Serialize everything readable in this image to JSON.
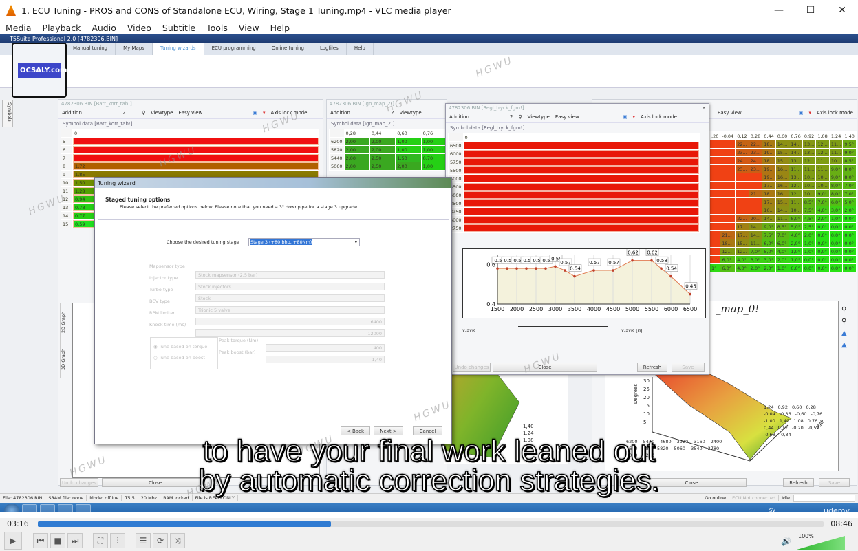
{
  "window": {
    "title": "1. ECU Tuning - PROS and CONS of Standalone ECU, Wiring, Stage 1 Tuning.mp4 - VLC media player",
    "minimize": "—",
    "maximize": "☐",
    "close": "✕"
  },
  "menu": [
    "Media",
    "Playback",
    "Audio",
    "Video",
    "Subtitle",
    "Tools",
    "View",
    "Help"
  ],
  "app": {
    "title": "T5Suite Professional 2.0 [4782306.BIN]",
    "tabs": [
      "Manual tuning",
      "My Maps",
      "Tuning wizards",
      "ECU programming",
      "Online tuning",
      "Logfiles",
      "Help"
    ],
    "active_tab": 2,
    "logo": "OCSALY.com",
    "symbols_tab": "Symbols"
  },
  "toolbar": {
    "mode": "Addition",
    "amount": "2",
    "viewtype_label": "Viewtype",
    "viewtype": "Easy view",
    "axis_lock": "Axis lock mode"
  },
  "batt": {
    "header": "4782306.BIN [Batt_korr_tab!]",
    "symlabel": "Symbol data [Batt_korr_tab!]",
    "col": "0",
    "rows": [
      {
        "r": "5",
        "v": "",
        "c": "#f01010"
      },
      {
        "r": "6",
        "v": "",
        "c": "#f01010"
      },
      {
        "r": "7",
        "v": "",
        "c": "#f01010"
      },
      {
        "r": "8",
        "v": "1,72",
        "c": "#b06000"
      },
      {
        "r": "9",
        "v": "1,85",
        "c": "#8a7a00"
      },
      {
        "r": "10",
        "v": "1,50",
        "c": "#6f9000"
      },
      {
        "r": "11",
        "v": "1,28",
        "c": "#50a000"
      },
      {
        "r": "12",
        "v": "0,94",
        "c": "#30c010"
      },
      {
        "r": "13",
        "v": "0,78",
        "c": "#25d015"
      },
      {
        "r": "14",
        "v": "0,77",
        "c": "#25d015"
      },
      {
        "r": "15",
        "v": "0,59",
        "c": "#20e020"
      }
    ]
  },
  "ign2": {
    "header": "4782306.BIN [Ign_map_2!]",
    "symlabel": "Symbol data [Ign_map_2!]",
    "cols": [
      "0,28",
      "0,44",
      "0,60",
      "0,76"
    ],
    "rows": [
      {
        "r": "6200",
        "v": [
          "2,00",
          "2,00",
          "1,00",
          "1,00"
        ]
      },
      {
        "r": "5820",
        "v": [
          "2,00",
          "2,00",
          "1,00",
          "1,00"
        ]
      },
      {
        "r": "5440",
        "v": [
          "2,00",
          "2,50",
          "1,50",
          "0,70"
        ]
      },
      {
        "r": "5060",
        "v": [
          "2,00",
          "2,50",
          "2,00",
          "1,00"
        ]
      }
    ]
  },
  "regl": {
    "header": "4782306.BIN [Regl_tryck_fgm!]",
    "symlabel": "Symbol data [Regl_tryck_fgm!]",
    "col": "0",
    "rows": [
      "6500",
      "6000",
      "5750",
      "5500",
      "5000",
      "4500",
      "4000",
      "3500",
      "3250",
      "3000",
      "2750"
    ],
    "xaxis_label": "x-axis",
    "xaxis_value": "x-axis [0]",
    "undo": "Undo changes",
    "close": "Close",
    "refresh": "Refresh",
    "save": "Save"
  },
  "chart_data": {
    "type": "line",
    "x": [
      1500,
      1750,
      2000,
      2250,
      2500,
      2750,
      3000,
      3250,
      3500,
      4000,
      4500,
      5000,
      5500,
      5750,
      6000,
      6500
    ],
    "values": [
      0.58,
      0.58,
      0.58,
      0.58,
      0.58,
      0.58,
      0.59,
      0.57,
      0.54,
      0.57,
      0.57,
      0.62,
      0.62,
      0.58,
      0.54,
      0.45
    ],
    "labels": [
      "0.5",
      "0.5",
      "0.5",
      "0.5",
      "0.5",
      "0.5",
      "0.5(",
      "0.57",
      "0.54",
      "0.57",
      "0.57",
      "0.62",
      "0.62",
      "0.58",
      "0.54",
      "0.45"
    ],
    "xticks": [
      "1500",
      "2000",
      "2500",
      "3000",
      "3500",
      "4000",
      "4500",
      "5000",
      "5500",
      "6000",
      "6500"
    ],
    "yticks": [
      "0.4",
      "0.6"
    ],
    "ylim": [
      0.4,
      0.65
    ],
    "xlim": [
      1500,
      6500
    ],
    "grid": true
  },
  "ign0": {
    "title": "_map_0!",
    "cols": [
      ",20",
      "-0,04",
      "0,12",
      "0,28",
      "0,44",
      "0,60",
      "0,76",
      "0,92",
      "1,08",
      "1,24",
      "1,40"
    ],
    "rows": [
      [
        "",
        "",
        "22...",
        "22...",
        "18...",
        "14...",
        "14...",
        "13...",
        "12...",
        "11...",
        "9,5°"
      ],
      [
        "",
        "",
        "23...",
        "23...",
        "19...",
        "15...",
        "14...",
        "13...",
        "12...",
        "11...",
        "9,0°"
      ],
      [
        "",
        "",
        "24...",
        "24...",
        "18...",
        "15...",
        "13...",
        "12...",
        "11...",
        "10...",
        "8,5°"
      ],
      [
        "",
        "",
        "23...",
        "23...",
        "19...",
        "16...",
        "11...",
        "11...",
        "11...",
        "9,0°",
        "8,0°"
      ],
      [
        "",
        "",
        "",
        "",
        "19...",
        "16...",
        "13...",
        "10...",
        "10...",
        "9,0°",
        "8,0°"
      ],
      [
        "",
        "",
        "",
        "",
        "17...",
        "16...",
        "12...",
        "10...",
        "10...",
        "8,0°",
        "7,0°"
      ],
      [
        "",
        "",
        "",
        "21...",
        "18...",
        "16...",
        "12...",
        "10...",
        "9,0°",
        "8,0°",
        "7,0°"
      ],
      [
        "",
        "",
        "",
        "",
        "17...",
        "15...",
        "11...",
        "8,5°",
        "7,0°",
        "6,0°",
        "5,0°"
      ],
      [
        "",
        "",
        "",
        "",
        "16...",
        "14...",
        "10...",
        "7,5°",
        "4,0°",
        "3,0°",
        "2,0°"
      ],
      [
        "",
        "",
        "22...",
        "20...",
        "14...",
        "11...",
        "8,0°",
        "4,5°",
        "2,0°",
        "1,0°",
        "0,0°"
      ],
      [
        "",
        "",
        "17...",
        "14...",
        "9,0°",
        "8,5°",
        "5,0°",
        "2,5°",
        "0,0°",
        "0,0°",
        "0,0°"
      ],
      [
        "",
        "21...",
        "17...",
        "14...",
        "7,5°",
        "7,0°",
        "4,0°",
        "2,0°",
        "0,0°",
        "0,0°",
        "0,0°"
      ],
      [
        "",
        "18...",
        "15...",
        "11...",
        "6,0°",
        "6,0°",
        "2,0°",
        "1,0°",
        "0,0°",
        "0,0°",
        "0,0°"
      ],
      [
        "",
        "12...",
        "12...",
        "7,0°",
        "5,0°",
        "4,0°",
        "1,0°",
        "1,0°",
        "0,0°",
        "0,0°",
        "0,0°"
      ],
      [
        "",
        "6,0°",
        "4,0°",
        "3,0°",
        "3,0°",
        "2,0°",
        "1,0°",
        "0,0°",
        "0,0°",
        "0,0°",
        "0,0°"
      ],
      [
        "1°",
        "6,0°",
        "4,0°",
        "2,0°",
        "2,0°",
        "1,0°",
        "0,0°",
        "0,0°",
        "0,0°",
        "0,0°",
        "0,0°"
      ]
    ],
    "zlabel": "Degrees",
    "ylabel": "MAP",
    "zticks": [
      "30",
      "25",
      "20",
      "15",
      "10",
      "5"
    ],
    "rpm_ticks": [
      "6200",
      "5440",
      "4680",
      "3920",
      "3160",
      "2400",
      "1640",
      "880",
      "5820",
      "5060",
      "3540",
      "2780",
      "2020",
      "1260"
    ],
    "map_ticks": [
      "1,24",
      "0,92",
      "0,60",
      "0,28",
      "-0,04",
      "-0,36",
      "-0,60",
      "-0,76",
      "-1,00",
      "1,40",
      "1,08",
      "0,76",
      "0,44",
      "0,12",
      "-0,20",
      "-0,52",
      "-0,68",
      "-0,84"
    ]
  },
  "graph3d_left": {
    "tabs": [
      "3D Graph",
      "2D Graph"
    ],
    "xaxis": "x-axis",
    "ticks": [
      "1,40",
      "1,24",
      "1,08",
      "0,92",
      "0,76"
    ]
  },
  "wizard": {
    "title": "Tuning wizard",
    "heading": "Staged tuning options",
    "desc": "Please select the preferred options below. Please note that you need a 3\" downpipe for a stage 3 upgrade!",
    "stage_label": "Choose the desired tuning stage",
    "stage_value": "Stage 3 (+80 bhp, +80Nm)",
    "fields": [
      {
        "label": "Mapsensor type",
        "value": ""
      },
      {
        "label": "Injector type",
        "value": "Stock mapsensor (2.5 bar)"
      },
      {
        "label": "Turbo type",
        "value": "Stock injectors"
      },
      {
        "label": "BCV type",
        "value": "Stock"
      },
      {
        "label": "RPM limiter",
        "value": "Trionic 5 valve"
      },
      {
        "label": "Knock time (ms)",
        "value": "6400"
      },
      {
        "label": "",
        "value": "12000"
      }
    ],
    "radio_torque": "Tune based on torque",
    "radio_boost": "Tune based on boost",
    "peak_torque_label": "Peak torque (Nm)",
    "peak_torque": "400",
    "peak_boost_label": "Peak boost (bar)",
    "peak_boost": "1,40",
    "back": "< Back",
    "next": "Next >",
    "cancel": "Cancel"
  },
  "bottom": {
    "undo": "Undo changes",
    "close": "Close",
    "close2": "Close",
    "refresh": "Refresh",
    "save": "Save"
  },
  "status": {
    "items": [
      "File: 4782306.BIN",
      "SRAM file: none",
      "Mode: offline",
      "T5.5",
      "20 Mhz",
      "RAM locked",
      "File is READ ONLY"
    ],
    "go_online": "Go online",
    "ecu": "ECU Not connected",
    "idle": "Idle"
  },
  "subtitle": {
    "line1": "to have your final work leaned out",
    "line2": "by automatic correction strategies."
  },
  "taskbar": {
    "lang": "SV",
    "watermark": "udemy"
  },
  "watermark": "HGWU",
  "player": {
    "elapsed": "03:16",
    "total": "08:46",
    "progress": 0.373,
    "volume": "100%",
    "volume_level": 1.0
  }
}
